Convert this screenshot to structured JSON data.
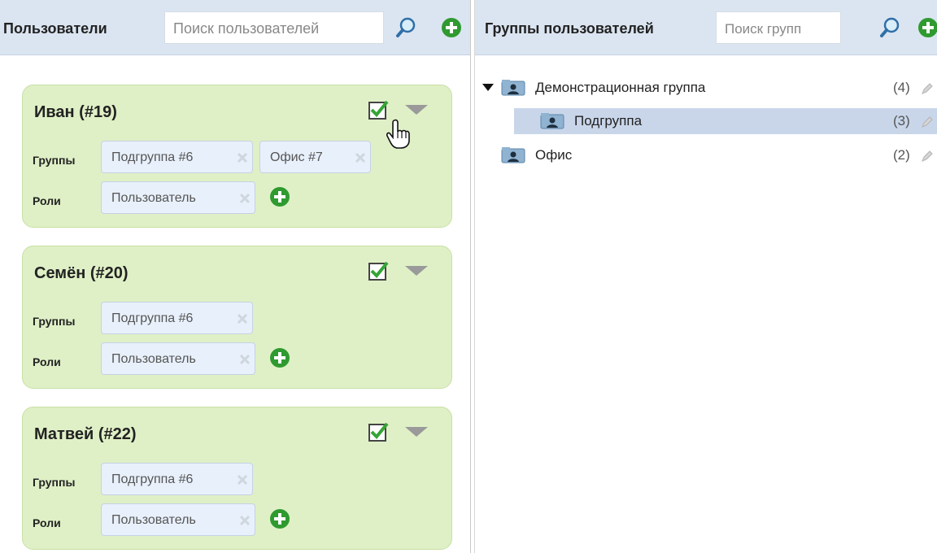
{
  "users_panel": {
    "title": "Пользователи",
    "search_placeholder": "Поиск пользователей",
    "users": [
      {
        "name": "Иван (#19)",
        "groups_label": "Группы",
        "groups": [
          "Подгруппа #6",
          "Офис #7"
        ],
        "roles_label": "Роли",
        "roles": [
          "Пользователь"
        ]
      },
      {
        "name": "Семён (#20)",
        "groups_label": "Группы",
        "groups": [
          "Подгруппа #6"
        ],
        "roles_label": "Роли",
        "roles": [
          "Пользователь"
        ]
      },
      {
        "name": "Матвей (#22)",
        "groups_label": "Группы",
        "groups": [
          "Подгруппа #6"
        ],
        "roles_label": "Роли",
        "roles": [
          "Пользователь"
        ]
      }
    ]
  },
  "groups_panel": {
    "title": "Группы пользователей",
    "search_placeholder": "Поиск групп",
    "tree": [
      {
        "label": "Демонстрационная группа",
        "count": "(4)",
        "expanded": true
      },
      {
        "label": "Подгруппа",
        "count": "(3)",
        "selected": true
      },
      {
        "label": "Офис",
        "count": "(2)"
      }
    ]
  },
  "colors": {
    "header_bg": "#dbe5f1",
    "card_bg": "#dff0c6",
    "tag_bg": "#e8f0fb",
    "selected_row": "#c9d6ea",
    "add_green": "#2f9a2f"
  },
  "icons": [
    "search-icon",
    "add-icon",
    "checkbox-checked-icon",
    "dropdown-arrow-icon",
    "remove-icon",
    "folder-user-icon",
    "edit-pencil-icon",
    "hand-cursor-icon"
  ]
}
